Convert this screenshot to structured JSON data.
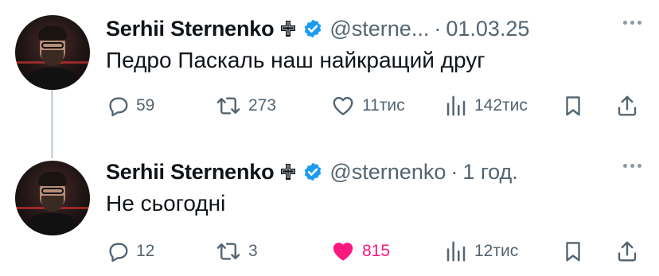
{
  "tweets": [
    {
      "author": "Serhii Sternenko",
      "handle": "@sterne...",
      "separator": "·",
      "time": "01.03.25",
      "text": "Педро Паскаль наш найкращий друг",
      "replies": "59",
      "reposts": "273",
      "likes": "11тис",
      "views": "142тис",
      "liked": false
    },
    {
      "author": "Serhii Sternenko",
      "handle": "@sternenko",
      "separator": "·",
      "time": "1 год.",
      "text": "Не сьогодні",
      "replies": "12",
      "reposts": "3",
      "likes": "815",
      "views": "12тис",
      "liked": true
    }
  ],
  "colors": {
    "text": "#0f1419",
    "secondary": "#536471",
    "verified": "#1d9bf0",
    "like_active": "#f91880",
    "thread_line": "#cfd9de"
  },
  "icons": [
    "cross-badge-icon",
    "verified-badge-icon",
    "more-icon",
    "reply-icon",
    "repost-icon",
    "like-icon",
    "views-icon",
    "bookmark-icon",
    "share-icon"
  ]
}
